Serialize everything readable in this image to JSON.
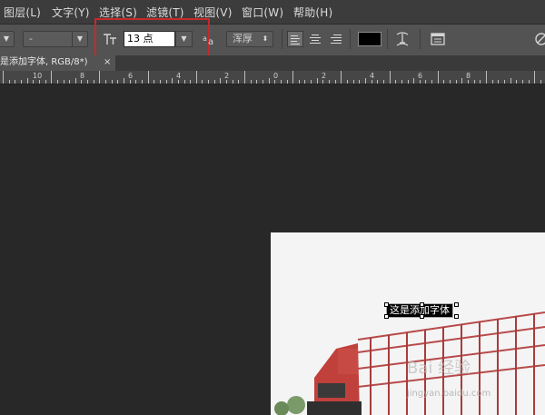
{
  "menu": {
    "items": [
      {
        "label": "图层(L)"
      },
      {
        "label": "文字(Y)"
      },
      {
        "label": "选择(S)"
      },
      {
        "label": "滤镜(T)"
      },
      {
        "label": "视图(V)"
      },
      {
        "label": "窗口(W)"
      },
      {
        "label": "帮助(H)"
      }
    ]
  },
  "options": {
    "font_style_value": "-",
    "font_size_value": "13 点",
    "antialias_label": "浑厚",
    "text_color": "#000000",
    "size_icon": "font-size-icon",
    "aa_icon": "antialias-icon",
    "warp_icon": "warp-text-icon",
    "panel_icon": "character-panel-icon",
    "highlight_color": "#c8282a"
  },
  "document": {
    "tab_title": "是添加字体, RGB/8*)",
    "tab_close": "×",
    "text_layer": "这是添加字体"
  },
  "ruler": {
    "labels": [
      "10",
      "8",
      "6",
      "4",
      "2",
      "0",
      "2",
      "4",
      "6",
      "8"
    ]
  },
  "watermark": "jingyan.baidu.com"
}
